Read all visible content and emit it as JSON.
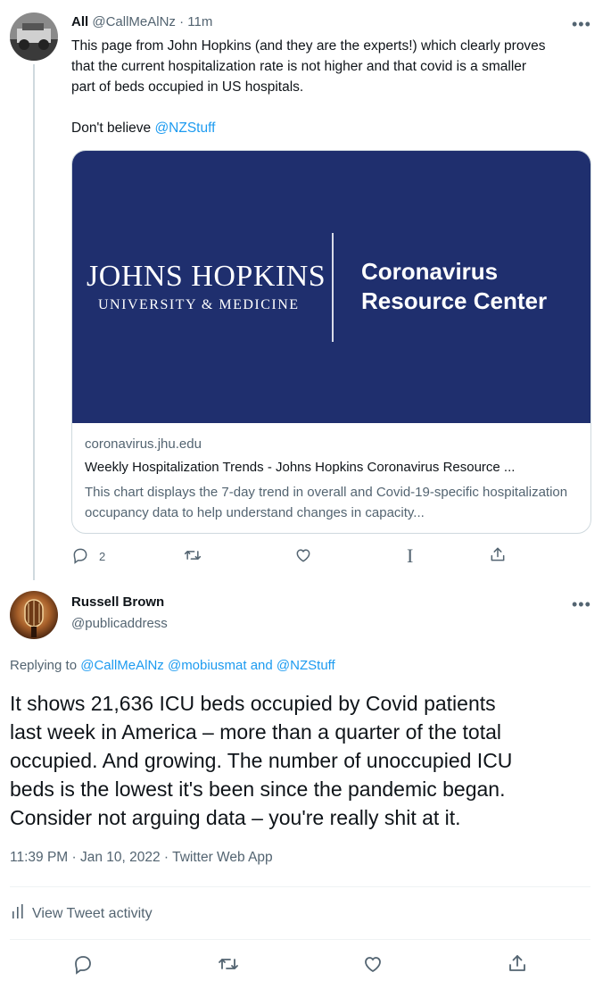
{
  "tweet1": {
    "author_name": "All",
    "handle": "@CallMeAlNz",
    "separator": "·",
    "time": "11m",
    "more": "•••",
    "text_lines": [
      "This page from John Hopkins (and they are the experts!) which clearly proves",
      "that the current hospitalization rate is not higher and that covid is a smaller",
      "part of beds occupied in US hospitals."
    ],
    "text_prefix": "Don't believe ",
    "mention": "@NZStuff",
    "card": {
      "logo_main": "JOHNS HOPKINS",
      "logo_sub": "UNIVERSITY & MEDICINE",
      "brand_line1": "Coronavirus",
      "brand_line2": "Resource Center",
      "domain": "coronavirus.jhu.edu",
      "title": "Weekly Hospitalization Trends - Johns Hopkins Coronavirus Resource ...",
      "description": "This chart displays the 7-day trend in overall and Covid-19-specific hospitalization occupancy data to help understand changes in capacity..."
    },
    "actions": {
      "reply_count": "2",
      "analytics_glyph": "I"
    }
  },
  "tweet2": {
    "author_name": "Russell Brown",
    "handle": "@publicaddress",
    "more": "•••",
    "replying_prefix": "Replying to ",
    "replying_to": "@CallMeAlNz @mobiusmat",
    "replying_and": " and ",
    "replying_last": "@NZStuff",
    "text_lines": [
      "It shows 21,636 ICU beds occupied by Covid patients",
      "last week in America – more than a quarter of the total",
      "occupied. And growing. The number of unoccupied ICU",
      "beds is the lowest it's been since the pandemic began.",
      "Consider not arguing data – you're really shit at it."
    ],
    "timestamp": "11:39 PM · Jan 10, 2022 · Twitter Web App",
    "activity_label": "View Tweet activity"
  },
  "colors": {
    "link": "#1d9bf0",
    "muted": "#536471",
    "card_bg": "#1f2f6e"
  },
  "icons": [
    "reply-icon",
    "retweet-icon",
    "like-icon",
    "analytics-icon",
    "share-icon",
    "bar-chart-icon"
  ]
}
